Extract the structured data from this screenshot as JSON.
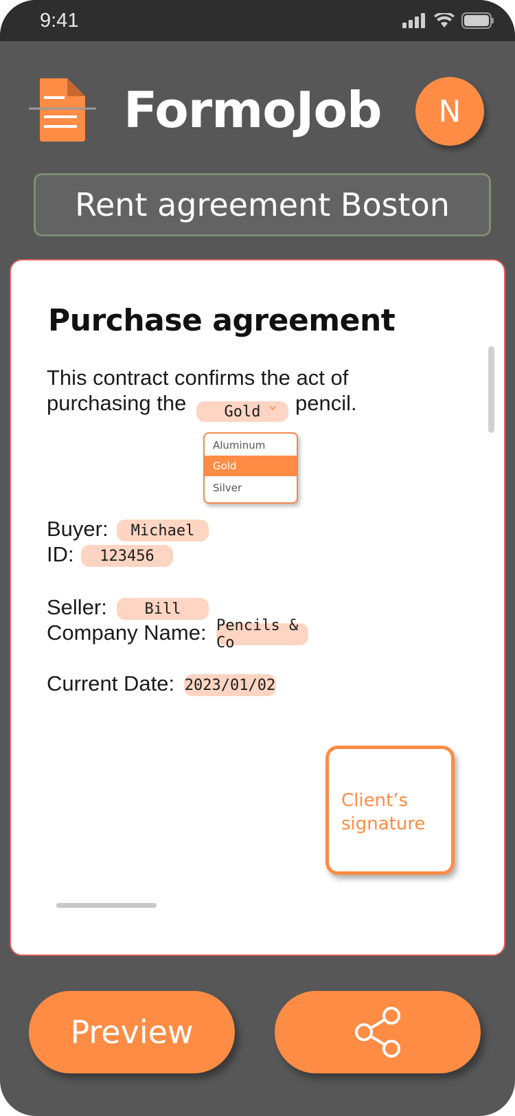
{
  "status_bar": {
    "time": "9:41"
  },
  "app": {
    "name": "FormoJob",
    "avatar_initial": "N"
  },
  "document": {
    "title": "Rent agreement Boston"
  },
  "contract": {
    "heading": "Purchase agreement",
    "intro_line1": "This contract confirms the act of",
    "intro_line2_prefix": "purchasing the",
    "intro_line2_suffix": "pencil.",
    "material_select": {
      "selected": "Gold",
      "options": [
        "Aluminum",
        "Gold",
        "Silver"
      ]
    },
    "buyer_label": "Buyer:",
    "buyer_value": "Michael",
    "id_label": "ID:",
    "id_value": "123456",
    "seller_label": "Seller:",
    "seller_value": "Bill",
    "company_label": "Company Name:",
    "company_value": "Pencils & Co",
    "date_label": "Current Date:",
    "date_value": "2023/01/02",
    "signature_label": "Client’s signature"
  },
  "actions": {
    "preview_label": "Preview",
    "share_icon": "share-icon"
  },
  "colors": {
    "accent": "#ff8c45",
    "background": "#575757",
    "chip": "#fdd5c2"
  }
}
